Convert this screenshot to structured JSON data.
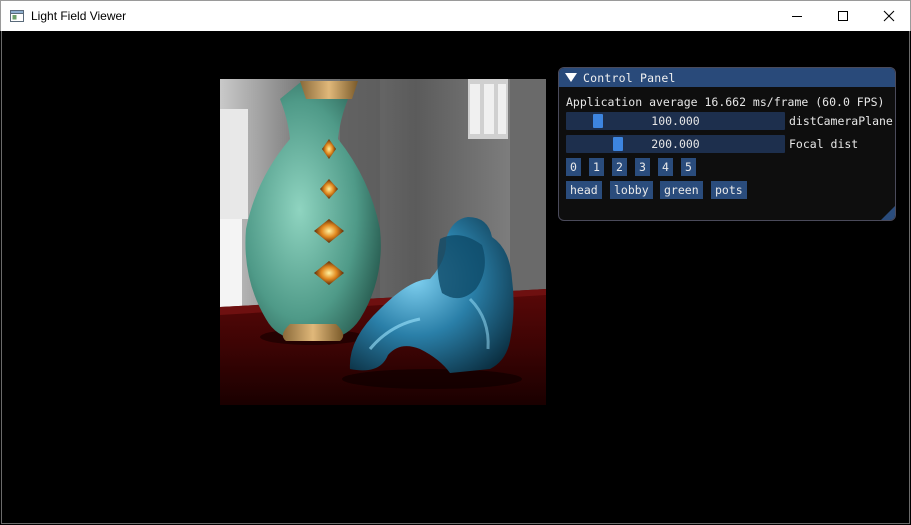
{
  "window": {
    "title": "Light Field Viewer",
    "icon": "app-window-icon"
  },
  "panel": {
    "title": "Control Panel",
    "fps_text": "Application average 16.662 ms/frame (60.0 FPS)",
    "sliders": [
      {
        "value_text": "100.000",
        "label": "distCameraPlane",
        "level": 0.12
      },
      {
        "value_text": "200.000",
        "label": "Focal dist",
        "level": 0.22
      }
    ],
    "number_buttons": [
      "0",
      "1",
      "2",
      "3",
      "4",
      "5"
    ],
    "scene_buttons": [
      "head",
      "lobby",
      "green",
      "pots"
    ]
  },
  "colors": {
    "title_bar": "#294a7a",
    "slider_bg": "#1d2f4d",
    "slider_grab": "#3d85e0",
    "button_bg": "#2a4c7c"
  }
}
